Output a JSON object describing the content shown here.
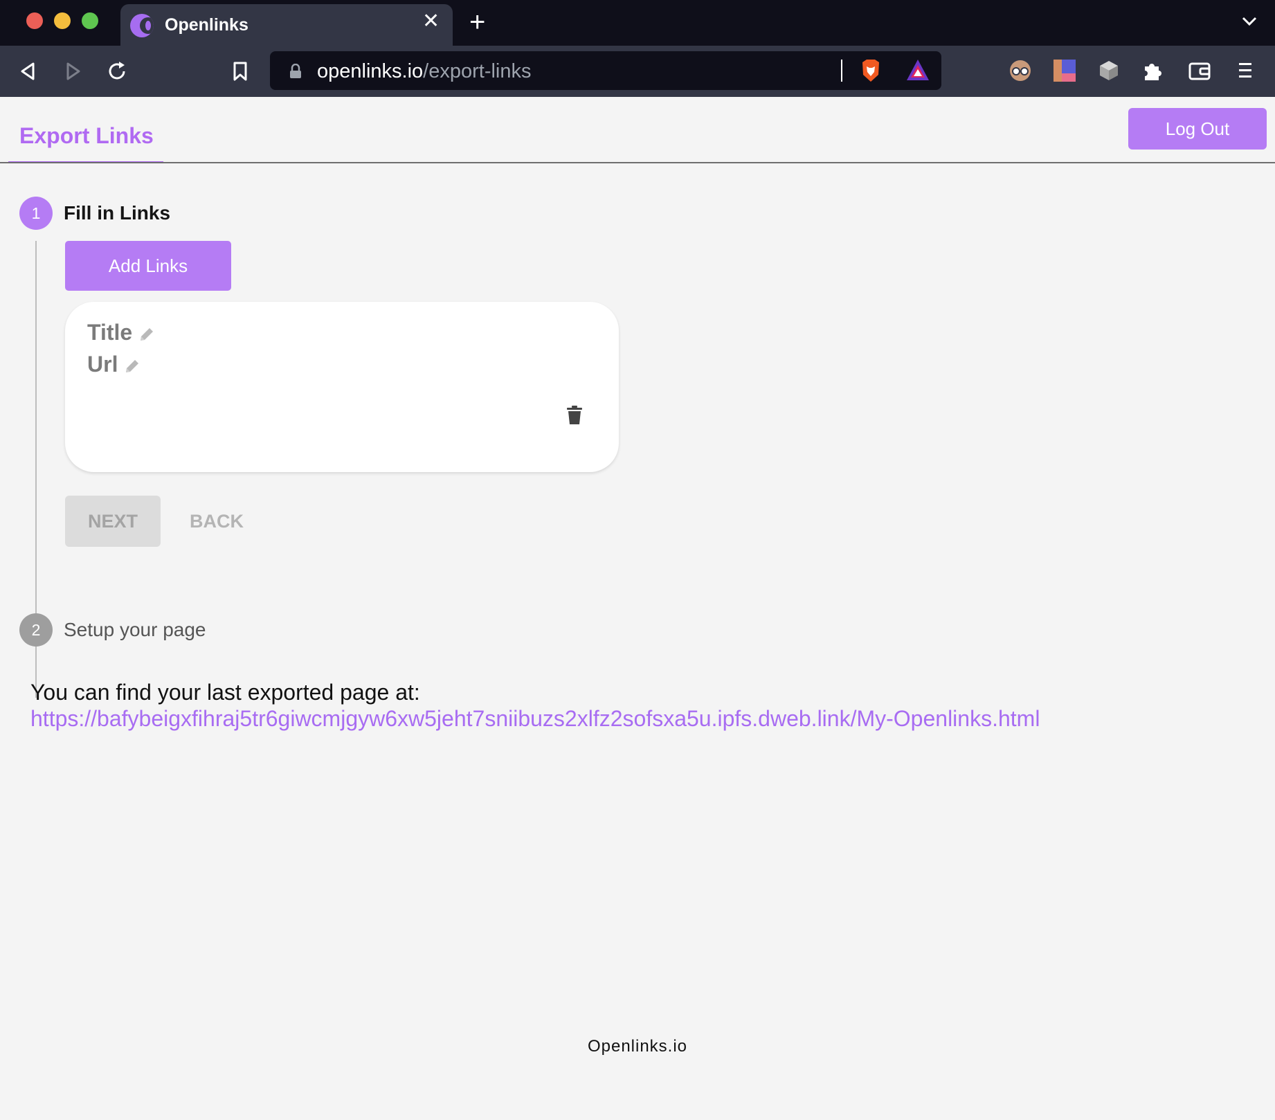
{
  "browser": {
    "tab": {
      "title": "Openlinks",
      "close": "✕"
    },
    "new_tab": "+",
    "url": {
      "host": "openlinks.io",
      "path": "/export-links"
    }
  },
  "header": {
    "tab_label": "Export Links",
    "logout_label": "Log Out"
  },
  "stepper": {
    "step1": {
      "number": "1",
      "label": "Fill in Links"
    },
    "add_links_label": "Add Links",
    "card": {
      "title_label": "Title",
      "url_label": "Url"
    },
    "next_label": "NEXT",
    "back_label": "BACK",
    "step2": {
      "number": "2",
      "label": "Setup your page"
    }
  },
  "export": {
    "message": "You can find your last exported page at:",
    "link": "https://bafybeigxfihraj5tr6giwcmjgyw6xw5jeht7sniibuzs2xlfz2sofsxa5u.ipfs.dweb.link/My-Openlinks.html"
  },
  "footer": "Openlinks.io",
  "colors": {
    "accent": "#b57cf4",
    "link": "#a86cf2",
    "chrome_dark": "#0f0f1a",
    "chrome": "#333645"
  }
}
